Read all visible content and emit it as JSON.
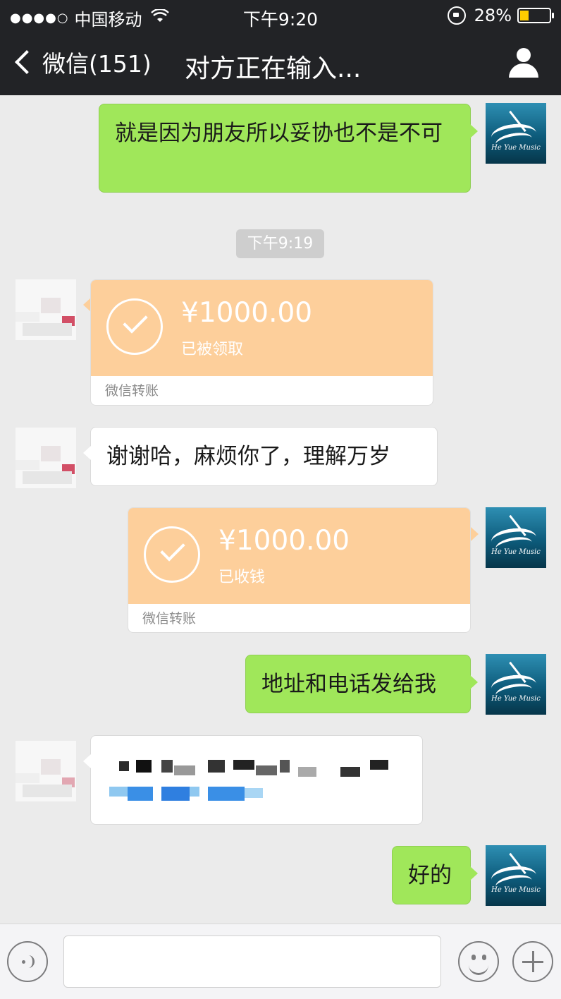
{
  "status_bar": {
    "carrier": "中国移动",
    "time": "下午9:20",
    "battery": "28%",
    "signal_icon": "signal-dots-icon",
    "wifi_icon": "wifi-icon"
  },
  "nav": {
    "back_label": "微信(151)",
    "title": "对方正在输入..."
  },
  "messages": {
    "m1_text": "就是因为朋友所以妥协也不是不可",
    "timestamp": "下午9:19",
    "t1_amount": "¥1000.00",
    "t1_status": "已被领取",
    "t1_footer": "微信转账",
    "m2_text": "谢谢哈，麻烦你了，理解万岁",
    "t2_amount": "¥1000.00",
    "t2_status": "已收钱",
    "t2_footer": "微信转账",
    "m3_text": "地址和电话发给我",
    "m5_text": "好的"
  },
  "avatar": {
    "me_caption": "He Yue Music"
  },
  "colors": {
    "green_bubble": "#a0e75a",
    "transfer_orange": "#fdcf9b",
    "header_bg": "#222326"
  }
}
